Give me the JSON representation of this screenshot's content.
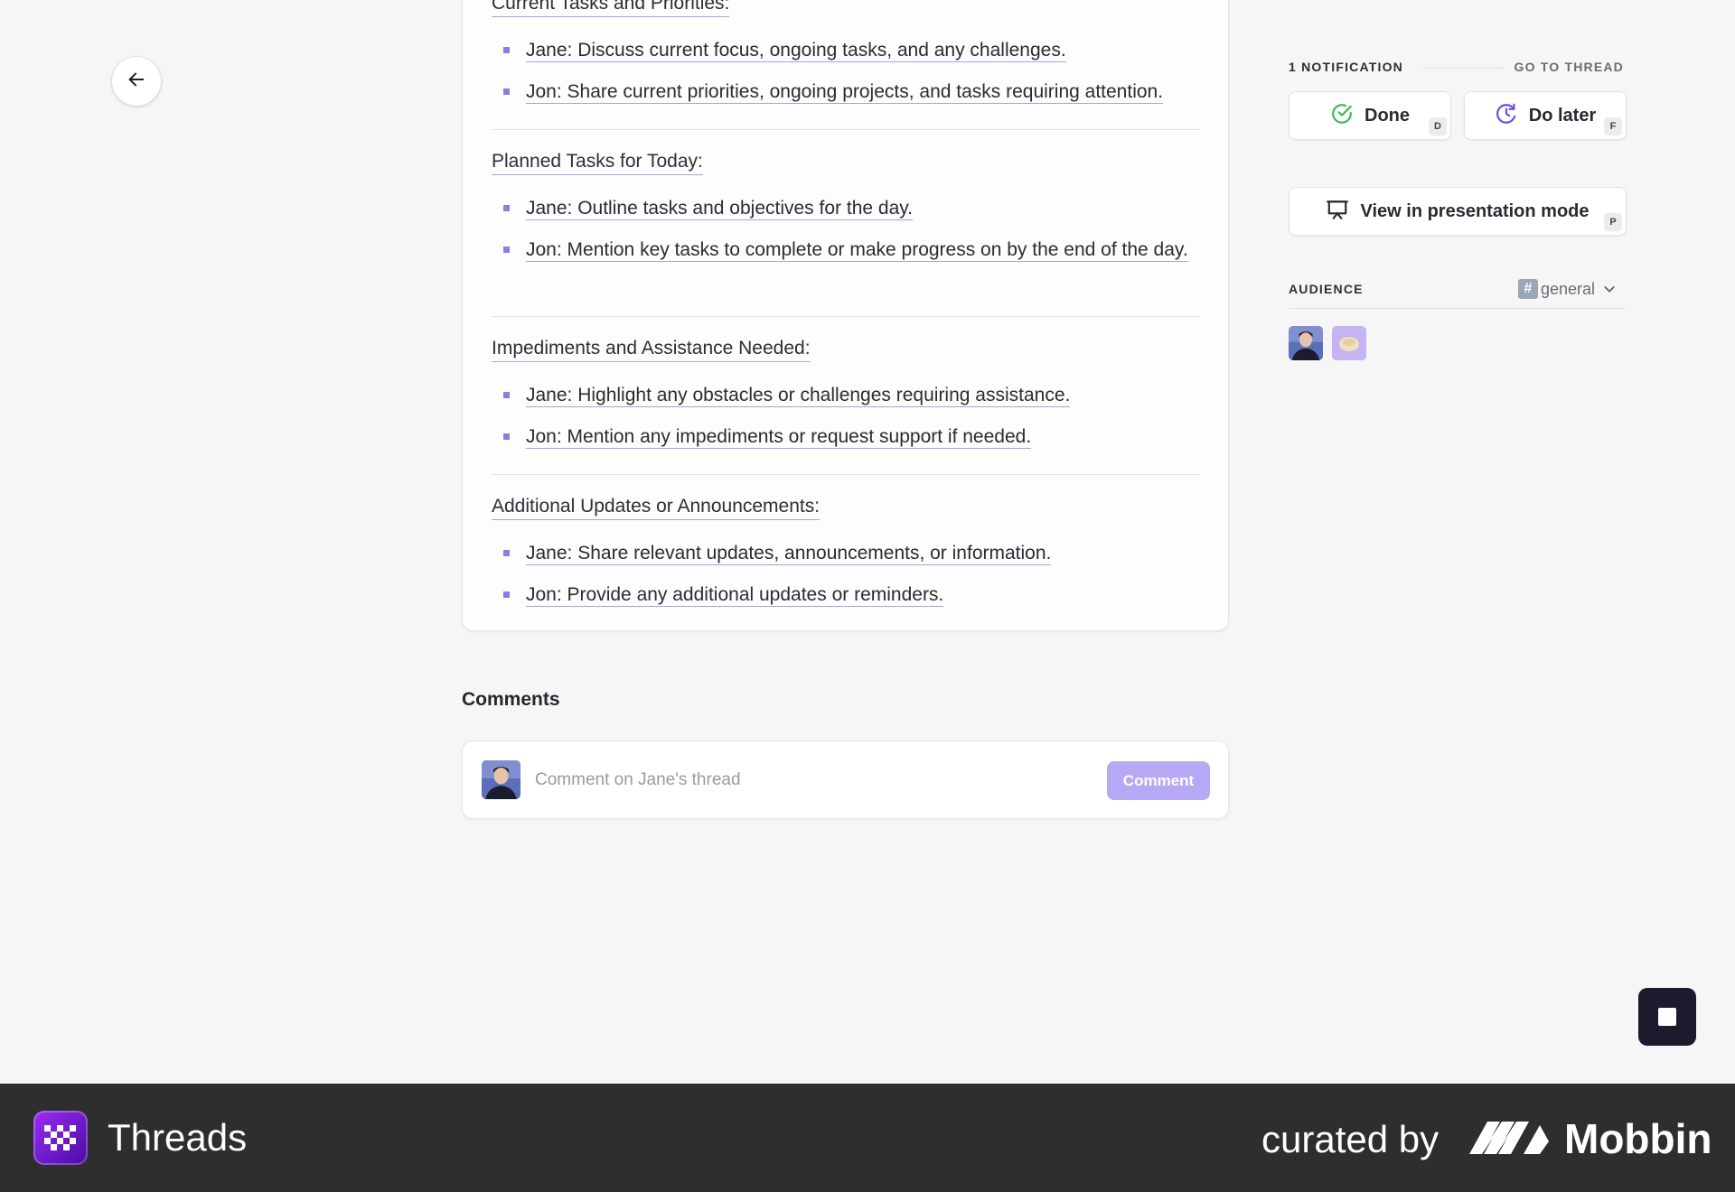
{
  "sections": [
    {
      "title": "Current Tasks and Priorities:",
      "items": [
        "Jane: Discuss current focus, ongoing tasks, and any challenges.",
        "Jon: Share current priorities, ongoing projects, and tasks requiring attention."
      ]
    },
    {
      "title": "Planned Tasks for Today:",
      "items": [
        "Jane: Outline tasks and objectives for the day.",
        "Jon: Mention key tasks to complete or make progress on by the end of the day."
      ]
    },
    {
      "title": "Impediments and Assistance Needed:",
      "items": [
        "Jane: Highlight any obstacles or challenges requiring assistance.",
        "Jon: Mention any impediments or request support if needed."
      ]
    },
    {
      "title": "Additional Updates or Announcements:",
      "items": [
        "Jane: Share relevant updates, announcements, or information.",
        "Jon: Provide any additional updates or reminders."
      ]
    }
  ],
  "comments": {
    "heading": "Comments",
    "placeholder": "Comment on Jane's thread",
    "button_label": "Comment"
  },
  "panel": {
    "notification_count": "1 NOTIFICATION",
    "go_to_thread": "GO TO THREAD",
    "done_label": "Done",
    "done_shortcut": "D",
    "do_later_label": "Do later",
    "do_later_shortcut": "F",
    "presentation_label": "View in presentation mode",
    "presentation_shortcut": "P",
    "audience_label": "AUDIENCE",
    "channel_name": "general",
    "channel_hash": "#"
  },
  "footer": {
    "app_name": "Threads",
    "curated_by": "curated by",
    "brand": "Mobbin"
  },
  "colors": {
    "accent": "#8b7ee3",
    "comment_button": "#b7a8f5",
    "done_check": "#3bb85a",
    "do_later_icon": "#6b4fe0",
    "footer_bg": "#2e2e2f"
  }
}
